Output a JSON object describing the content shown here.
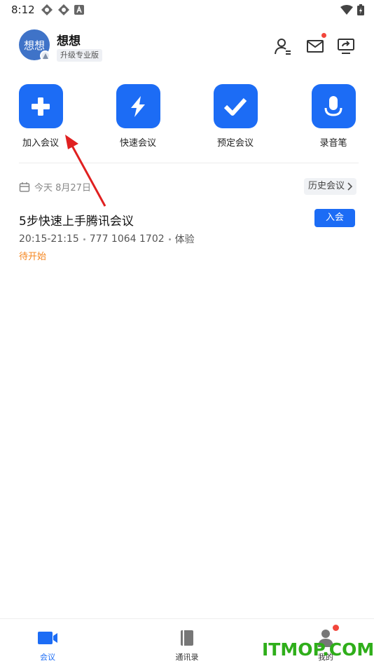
{
  "status_bar": {
    "time": "8:12"
  },
  "header": {
    "avatar_text": "想想",
    "user_name": "想想",
    "upgrade_label": "升级专业版"
  },
  "actions": [
    {
      "label": "加入会议",
      "icon": "plus-icon"
    },
    {
      "label": "快速会议",
      "icon": "lightning-icon"
    },
    {
      "label": "预定会议",
      "icon": "check-icon"
    },
    {
      "label": "录音笔",
      "icon": "microphone-icon"
    }
  ],
  "schedule": {
    "date_label": "今天 8月27日",
    "history_label": "历史会议"
  },
  "meeting": {
    "title": "5步快速上手腾讯会议",
    "time_range": "20:15-21:15",
    "meeting_id": "777 1064 1702",
    "type": "体验",
    "status": "待开始",
    "join_label": "入会"
  },
  "bottom_nav": [
    {
      "label": "会议",
      "icon": "video-camera-icon",
      "active": true
    },
    {
      "label": "通讯录",
      "icon": "contacts-book-icon",
      "active": false
    },
    {
      "label": "我的",
      "icon": "person-icon",
      "active": false
    }
  ],
  "watermark": "ITMOP.COM",
  "colors": {
    "accent": "#1c6cf5",
    "status_orange": "#f5861f",
    "badge_red": "#f2463b",
    "annotation_red": "#e02020",
    "watermark_green": "#2fae1a"
  }
}
